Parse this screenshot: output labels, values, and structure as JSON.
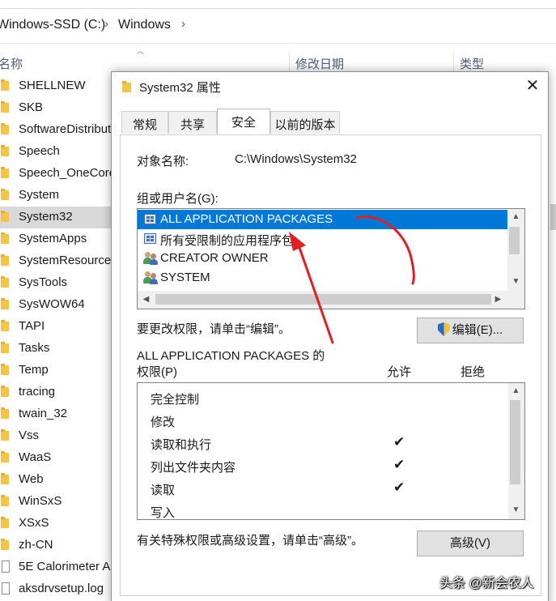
{
  "explorer": {
    "breadcrumb": [
      "Windows-SSD (C:)",
      "Windows"
    ],
    "columns": {
      "name": "名称",
      "modified": "修改日期",
      "type": "类型"
    },
    "files": [
      {
        "name": "SHELLNEW",
        "kind": "folder"
      },
      {
        "name": "SKB",
        "kind": "folder"
      },
      {
        "name": "SoftwareDistribution",
        "kind": "folder"
      },
      {
        "name": "Speech",
        "kind": "folder"
      },
      {
        "name": "Speech_OneCore",
        "kind": "folder"
      },
      {
        "name": "System",
        "kind": "folder"
      },
      {
        "name": "System32",
        "kind": "folder",
        "selected": true
      },
      {
        "name": "SystemApps",
        "kind": "folder"
      },
      {
        "name": "SystemResources",
        "kind": "folder"
      },
      {
        "name": "SysTools",
        "kind": "folder"
      },
      {
        "name": "SysWOW64",
        "kind": "folder"
      },
      {
        "name": "TAPI",
        "kind": "folder"
      },
      {
        "name": "Tasks",
        "kind": "folder"
      },
      {
        "name": "Temp",
        "kind": "folder"
      },
      {
        "name": "tracing",
        "kind": "folder"
      },
      {
        "name": "twain_32",
        "kind": "folder"
      },
      {
        "name": "Vss",
        "kind": "folder"
      },
      {
        "name": "WaaS",
        "kind": "folder"
      },
      {
        "name": "Web",
        "kind": "folder"
      },
      {
        "name": "WinSxS",
        "kind": "folder"
      },
      {
        "name": "XSxS",
        "kind": "folder"
      },
      {
        "name": "zh-CN",
        "kind": "folder"
      },
      {
        "name": "5E Calorimeter A",
        "kind": "file"
      },
      {
        "name": "aksdrvsetup.log",
        "kind": "file"
      }
    ]
  },
  "dialog": {
    "title": "System32 属性",
    "close_glyph": "✕",
    "tabs": [
      {
        "label": "常规",
        "active": false
      },
      {
        "label": "共享",
        "active": false
      },
      {
        "label": "安全",
        "active": true
      },
      {
        "label": "以前的版本",
        "active": false
      }
    ],
    "object_name_label": "对象名称:",
    "object_name_value": "C:\\Windows\\System32",
    "groups_label": "组或用户名(G):",
    "groups": [
      {
        "name": "ALL APPLICATION PACKAGES",
        "icon": "package-icon",
        "selected": true
      },
      {
        "name": "所有受限制的应用程序包",
        "icon": "package-icon",
        "selected": false
      },
      {
        "name": "CREATOR OWNER",
        "icon": "users-icon",
        "selected": false
      },
      {
        "name": "SYSTEM",
        "icon": "users-icon",
        "selected": false
      }
    ],
    "change_hint": "要更改权限，请单击“编辑”。",
    "edit_button": "编辑(E)...",
    "permissions_title_line1": "ALL APPLICATION PACKAGES 的",
    "permissions_title_line2": "权限(P)",
    "allow_header": "允许",
    "deny_header": "拒绝",
    "permissions": [
      {
        "name": "完全控制",
        "allow": false,
        "deny": false
      },
      {
        "name": "修改",
        "allow": false,
        "deny": false
      },
      {
        "name": "读取和执行",
        "allow": true,
        "deny": false
      },
      {
        "name": "列出文件夹内容",
        "allow": true,
        "deny": false
      },
      {
        "name": "读取",
        "allow": true,
        "deny": false
      },
      {
        "name": "写入",
        "allow": false,
        "deny": false
      }
    ],
    "check_glyph": "✔",
    "advanced_hint": "有关特殊权限或高级设置，请单击“高级”。",
    "advanced_button": "高级(V)"
  },
  "watermark": "头条 @新会农人",
  "colors": {
    "selection": "#0078d7",
    "annotation": "#e02020"
  }
}
